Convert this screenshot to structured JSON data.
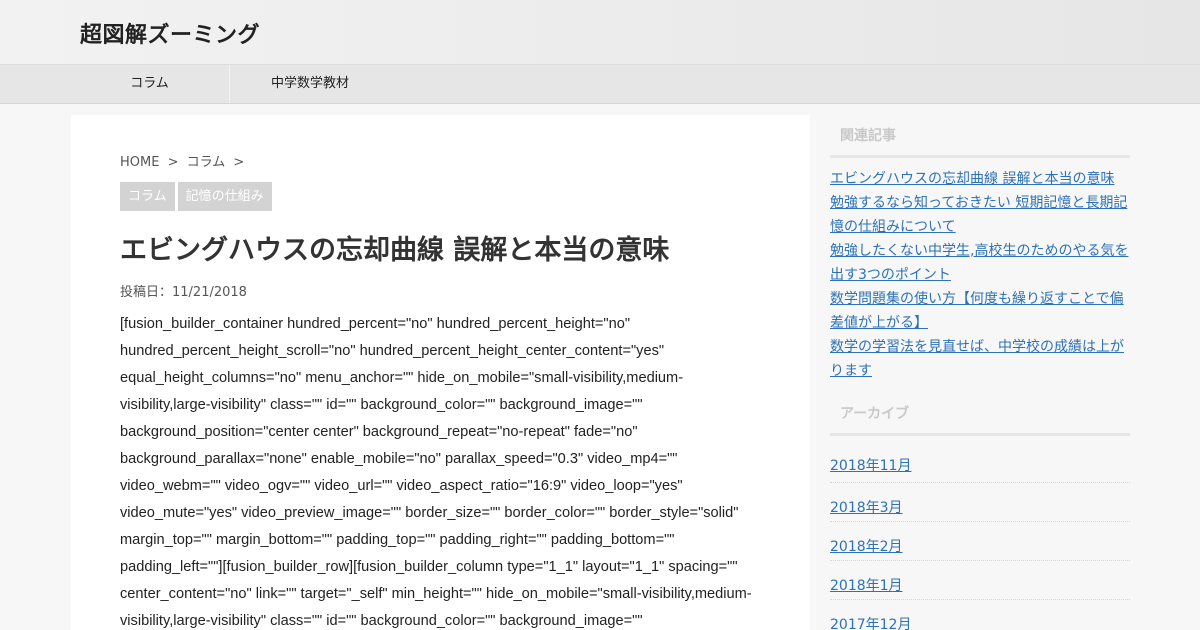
{
  "site": {
    "title": "超図解ズーミング"
  },
  "nav": {
    "items": [
      {
        "label": "コラム"
      },
      {
        "label": "中学数学教材"
      }
    ]
  },
  "breadcrumb": {
    "home": "HOME",
    "sep1": ">",
    "category": "コラム",
    "sep2": ">"
  },
  "tags": [
    {
      "label": "コラム"
    },
    {
      "label": "記憶の仕組み"
    }
  ],
  "post": {
    "title": "エビングハウスの忘却曲線 誤解と本当の意味",
    "date": "投稿日：11/21/2018",
    "body_lines": [
      "[fusion_builder_container hundred_percent=\"no\" hundred_percent_height=\"no\"",
      "hundred_percent_height_scroll=\"no\" hundred_percent_height_center_content=\"yes\"",
      "equal_height_columns=\"no\" menu_anchor=\"\" hide_on_mobile=\"small-visibility,medium-",
      "visibility,large-visibility\" class=\"\" id=\"\" background_color=\"\" background_image=\"\"",
      "background_position=\"center center\" background_repeat=\"no-repeat\" fade=\"no\"",
      "background_parallax=\"none\" enable_mobile=\"no\" parallax_speed=\"0.3\" video_mp4=\"\"",
      "video_webm=\"\" video_ogv=\"\" video_url=\"\" video_aspect_ratio=\"16:9\" video_loop=\"yes\"",
      "video_mute=\"yes\" video_preview_image=\"\" border_size=\"\" border_color=\"\" border_style=\"solid\"",
      "margin_top=\"\" margin_bottom=\"\" padding_top=\"\" padding_right=\"\" padding_bottom=\"\"",
      "padding_left=\"\"][fusion_builder_row][fusion_builder_column type=\"1_1\" layout=\"1_1\" spacing=\"\"",
      "center_content=\"no\" link=\"\" target=\"_self\" min_height=\"\" hide_on_mobile=\"small-visibility,medium-",
      "visibility,large-visibility\" class=\"\" id=\"\" background_color=\"\" background_image=\"\""
    ]
  },
  "sidebar": {
    "related_title": "関連記事",
    "related": [
      {
        "lines": [
          "エビングハウスの忘却曲線 誤解と本当の意味"
        ]
      },
      {
        "lines": [
          "勉強するなら知っておきたい 短期記憶と長期記",
          "憶の仕組みについて"
        ]
      },
      {
        "lines": [
          "勉強したくない中学生,高校生のためのやる気を",
          "出す3つのポイント"
        ]
      },
      {
        "lines": [
          "数学問題集の使い方【何度も繰り返すことで偏",
          "差値が上がる】"
        ]
      },
      {
        "lines": [
          "数学の学習法を見直せば、中学校の成績は上が",
          "ります"
        ]
      }
    ],
    "archives_title": "アーカイブ",
    "archives": [
      {
        "label": "2018年11月"
      },
      {
        "label": "2018年3月"
      },
      {
        "label": "2018年2月"
      },
      {
        "label": "2018年1月"
      },
      {
        "label": "2017年12月"
      }
    ]
  }
}
